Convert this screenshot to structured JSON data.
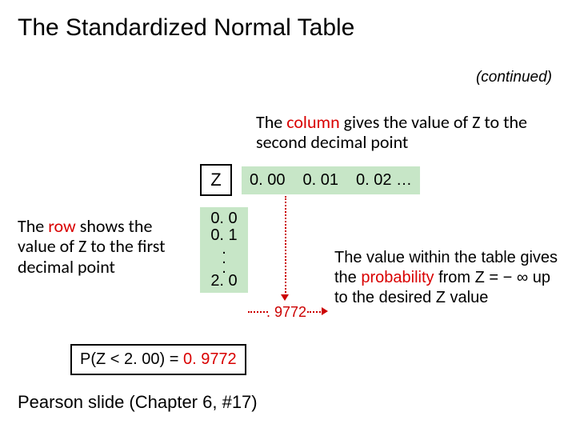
{
  "title": "The Standardized Normal Table",
  "continued": "(continued)",
  "column_desc": {
    "pre": "The ",
    "hl": "column",
    "post": " gives the value of Z to the second decimal point"
  },
  "row_desc": {
    "pre": "The ",
    "hl": "row",
    "post": " shows the value of Z to the first decimal point"
  },
  "value_desc": {
    "part1": "The value within the table gives the ",
    "hl": "probability",
    "part2": " from Z = − ∞ up to the desired Z value"
  },
  "z_label": "Z",
  "col_headers": [
    "0. 00",
    "0. 01",
    "0. 02 …"
  ],
  "row_stubs": [
    "0. 0",
    "0. 1",
    ".",
    ".",
    ".",
    "2. 0"
  ],
  "cell_value": ". 9772",
  "formula": {
    "lhs": "P(Z < 2. 00) = ",
    "rhs": "0. 9772"
  },
  "footer": "Pearson slide (Chapter 6, #17)"
}
